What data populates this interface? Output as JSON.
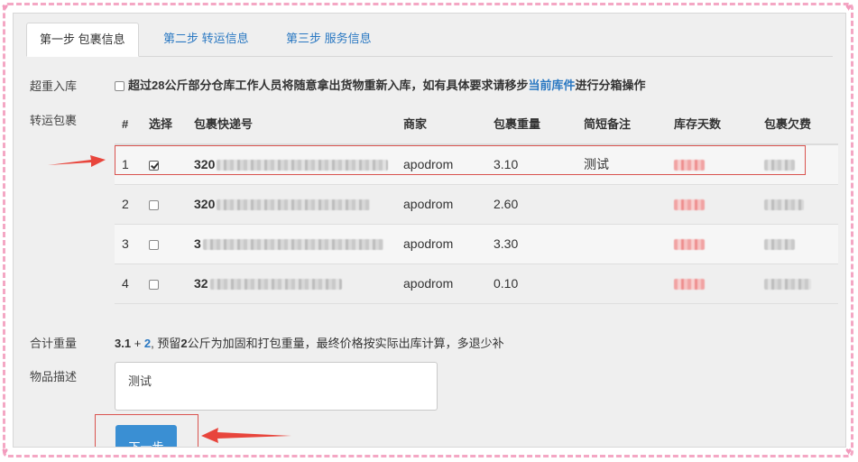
{
  "tabs": [
    {
      "label": "第一步 包裹信息",
      "active": true
    },
    {
      "label": "第二步 转运信息",
      "active": false
    },
    {
      "label": "第三步 服务信息",
      "active": false
    }
  ],
  "overweight": {
    "label": "超重入库",
    "text_before": "超过28公斤部分仓库工作人员将随意拿出货物重新入库，如有具体要求请移步",
    "link": "当前库件",
    "text_after": "进行分箱操作"
  },
  "packages": {
    "label": "转运包裹",
    "columns": [
      "#",
      "选择",
      "包裹快递号",
      "商家",
      "包裹重量",
      "简短备注",
      "库存天数",
      "包裹欠费"
    ],
    "rows": [
      {
        "index": "1",
        "checked": true,
        "tracking": "320",
        "merchant": "apodrom",
        "weight": "3.10",
        "note": "测试"
      },
      {
        "index": "2",
        "checked": false,
        "tracking": "320",
        "merchant": "apodrom",
        "weight": "2.60",
        "note": ""
      },
      {
        "index": "3",
        "checked": false,
        "tracking": "3",
        "merchant": "apodrom",
        "weight": "3.30",
        "note": ""
      },
      {
        "index": "4",
        "checked": false,
        "tracking": "32",
        "merchant": "apodrom",
        "weight": "0.10",
        "note": ""
      }
    ]
  },
  "total_weight": {
    "label": "合计重量",
    "value": "3.1",
    "plus": "+",
    "extra": "2",
    "text_a": ", 预留",
    "reserve": "2",
    "text_b": "公斤为加固和打包重量，最终价格按实际出库计算，多退少补"
  },
  "description": {
    "label": "物品描述",
    "value": "测试"
  },
  "next_button": "下一步",
  "colors": {
    "accent": "#2a78c2",
    "highlight": "#d9534f",
    "button": "#3a8fd3",
    "border_dash": "#f4a7c4"
  }
}
